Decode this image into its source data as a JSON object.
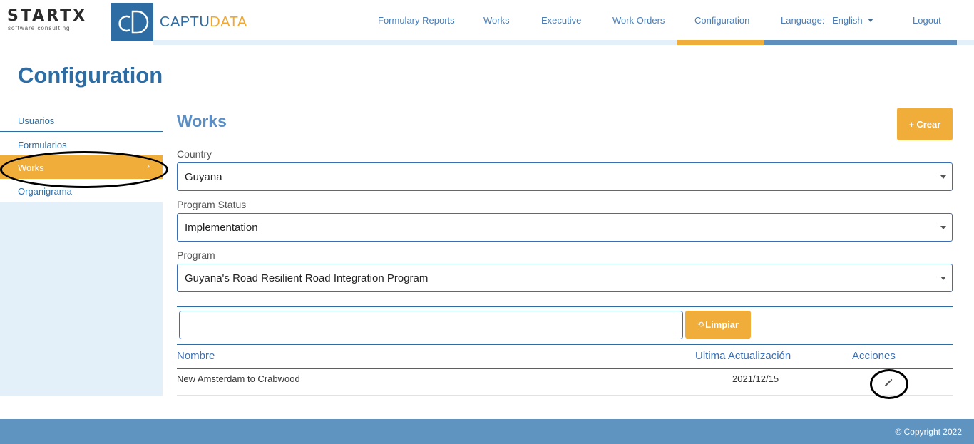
{
  "brand": {
    "startx": "STARTX",
    "startx_sub": "software consulting",
    "captu": "CAPTU",
    "data": "DATA"
  },
  "nav": {
    "items": [
      {
        "label": "Formulary Reports"
      },
      {
        "label": "Works"
      },
      {
        "label": "Executive"
      },
      {
        "label": "Work Orders"
      },
      {
        "label": "Configuration"
      }
    ],
    "language_label": "Language:",
    "language_value": "English",
    "logout": "Logout"
  },
  "page": {
    "title": "Configuration"
  },
  "sidebar": {
    "items": [
      {
        "label": "Usuarios"
      },
      {
        "label": "Formularios"
      },
      {
        "label": "Works"
      },
      {
        "label": "Organigrama"
      }
    ],
    "active_chevron": "›"
  },
  "works": {
    "title": "Works",
    "create_button": "Crear",
    "create_icon": "+",
    "fields": [
      {
        "label": "Country",
        "value": "Guyana"
      },
      {
        "label": "Program Status",
        "value": "Implementation"
      },
      {
        "label": "Program",
        "value": "Guyana's Road Resilient Road Integration Program"
      }
    ],
    "search": {
      "value": "",
      "placeholder": ""
    },
    "clear_button": "Limpiar",
    "clear_icon": "⟲"
  },
  "table": {
    "columns": [
      "Nombre",
      "Ultima Actualización",
      "Acciones"
    ],
    "rows": [
      {
        "nombre": "New Amsterdam to Crabwood",
        "fecha": "2021/12/15",
        "action_icon": "pencil-icon"
      }
    ]
  },
  "footer": {
    "copyright": "© Copyright 2022"
  },
  "colors": {
    "primary": "#2e6da4",
    "accent": "#f0ad3a",
    "light_bg": "#e3f0fa",
    "footer": "#5f94c0"
  }
}
